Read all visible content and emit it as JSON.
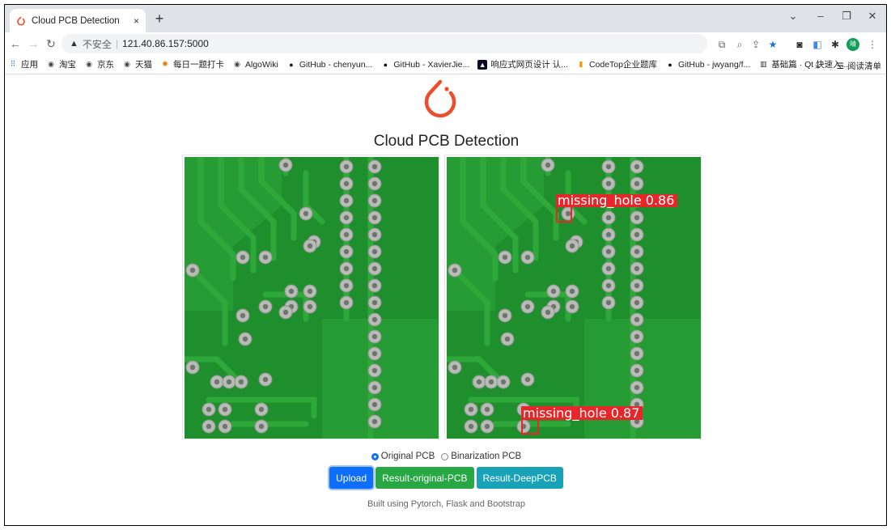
{
  "browser": {
    "tab_title": "Cloud PCB Detection",
    "tab_close": "×",
    "new_tab": "+",
    "security_label": "不安全",
    "url": "121.40.86.157:5000",
    "profile_initial": "晴"
  },
  "bookmarks": [
    {
      "label": "应用",
      "icon": "apps-grid-icon"
    },
    {
      "label": "淘宝",
      "icon": "globe-icon"
    },
    {
      "label": "京东",
      "icon": "globe-icon"
    },
    {
      "label": "天猫",
      "icon": "globe-icon"
    },
    {
      "label": "每日一题打卡",
      "icon": "daily-icon"
    },
    {
      "label": "AlgoWiki",
      "icon": "globe-icon"
    },
    {
      "label": "GitHub - chenyun...",
      "icon": "github-icon"
    },
    {
      "label": "GitHub - XavierJie...",
      "icon": "github-icon"
    },
    {
      "label": "响应式网页设计 认...",
      "icon": "freecodecamp-icon"
    },
    {
      "label": "CodeTop企业题库",
      "icon": "bar-chart-icon"
    },
    {
      "label": "GitHub - jwyang/f...",
      "icon": "github-icon"
    },
    {
      "label": "基础篇 · Qt 快速入...",
      "icon": "book-icon"
    }
  ],
  "bookmarks_more": "»",
  "reading_list": "阅读清单",
  "page": {
    "title": "Cloud PCB Detection",
    "detections": [
      {
        "label": "missing_hole 0.86"
      },
      {
        "label": "missing_hole 0.87"
      }
    ],
    "radio_original": "Original PCB",
    "radio_binarization": "Binarization PCB",
    "selected_mode": "Original PCB",
    "btn_upload": "Upload",
    "btn_result_original": "Result-original-PCB",
    "btn_result_deep": "Result-DeepPCB",
    "footer": "Built using Pytorch, Flask and Bootstrap"
  },
  "colors": {
    "pcb_green": "#1f8f2e",
    "trace_green": "#2fa83a",
    "detection_red": "#e8262a",
    "upload_blue": "#0d6efd",
    "result_green": "#28a745",
    "deep_teal": "#17a2b8",
    "logo_orange": "#ee4c2c"
  }
}
